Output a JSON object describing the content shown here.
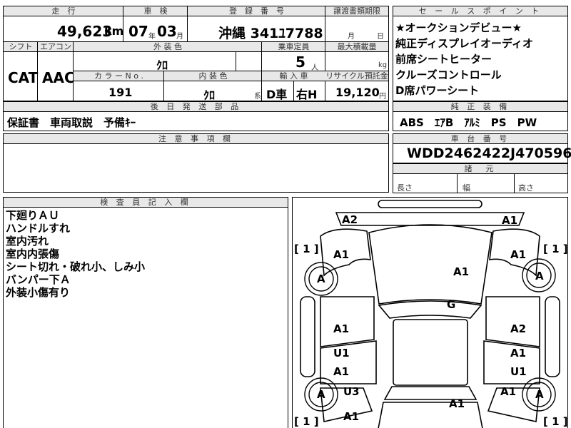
{
  "top": {
    "mileage_header": "走　行",
    "shaken_header": "車　検",
    "plate_header": "登　録　番　号",
    "transfer_header": "譲渡書類期限",
    "mileage": "49,623",
    "mileage_unit": "km",
    "shaken_year": "07",
    "shaken_year_unit": "年",
    "shaken_month": "03",
    "shaken_month_unit": "月",
    "plate": "沖縄 341ﾕ7788",
    "transfer_month_unit": "月",
    "transfer_day_unit": "日"
  },
  "row2": {
    "shift_header": "シフト",
    "ac_header": "エアコン",
    "exterior_header": "外 装 色",
    "capacity_header": "乗車定員",
    "load_header": "最大積載量",
    "shift": "CAT",
    "ac": "AAC",
    "exterior_color": "ｸﾛ",
    "capacity": "5",
    "capacity_unit": "人",
    "load_unit": "kg",
    "color_no_header": "カ ラ ー N o .",
    "interior_header": "内 装 色",
    "import_header": "輸 入 車",
    "recycle_header": "リサイクル預託金",
    "color_no": "191",
    "interior_color": "ｸﾛ",
    "interior_suffix": "系",
    "import_type": "D車",
    "steering": "右H",
    "recycle_fee": "19,120",
    "recycle_unit": "円"
  },
  "later_parts": {
    "header": "後 日 発 送 部 品",
    "value": "保証書　車両取説　予備ｷｰ"
  },
  "notes": {
    "header": "注 意 事 項 欄"
  },
  "sales_points": {
    "header": "セ ー ル ス ポ イ ン ト",
    "items": [
      "★オークションデビュー★",
      "純正ディスプレイオーディオ",
      "前席シートヒーター",
      "クルーズコントロール",
      "D席パワーシート"
    ]
  },
  "equipment": {
    "header": "純 正 装 備",
    "value": "ABS　ｴｱB　ｱﾙﾐ　PS　PW"
  },
  "chassis": {
    "header": "車 台 番 号",
    "value": "WDD2462422J470596"
  },
  "dimensions": {
    "header": "諸　元",
    "length_label": "長さ",
    "width_label": "幅",
    "height_label": "高さ"
  },
  "inspector": {
    "header": "検 査 員 記 入 欄",
    "lines": [
      "下廻りＡＵ",
      "ハンドルすれ",
      "室内汚れ",
      "室内内張傷",
      "シート切れ・破れ小、しみ小",
      "バンパー下Ａ",
      "外装小傷有り"
    ]
  },
  "diagram": {
    "marks": {
      "front_left": "A2",
      "front_right": "A1",
      "left_bracket_top": "[ 1 ]",
      "right_bracket_top": "[ 1 ]",
      "fender_left": "A1",
      "fender_right": "A1",
      "wheel_front_left": "A",
      "wheel_front_right": "A",
      "hood": "A1",
      "roof": "G",
      "door_fl": "A1",
      "door_fr": "A2",
      "door_rl_1": "U1",
      "door_rl_2": "A1",
      "door_rr_1": "A1",
      "door_rr_2": "U1",
      "wheel_rear_left": "A",
      "wheel_rear_right": "A",
      "quarter_left": "U3",
      "quarter_right": "A1",
      "trunk": "A1",
      "rear_left": "A1",
      "left_bracket_bottom": "[ 1 ]",
      "right_bracket_bottom": "[ 1 ]"
    }
  }
}
